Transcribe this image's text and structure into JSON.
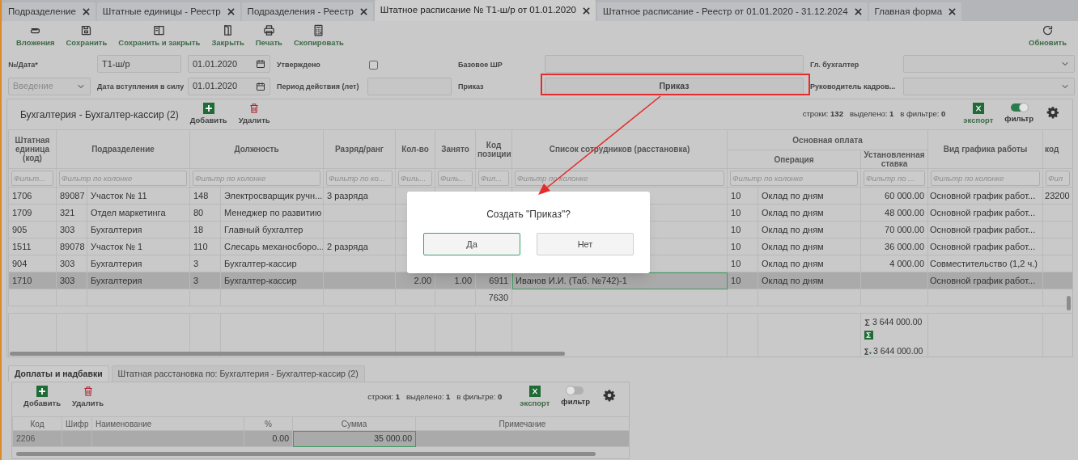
{
  "tabs": [
    {
      "label": "Подразделение",
      "selected": false
    },
    {
      "label": "Штатные единицы - Реестр",
      "selected": false
    },
    {
      "label": "Подразделения - Реестр",
      "selected": false
    },
    {
      "label": "Штатное расписание № Т1-ш/р от 01.01.2020",
      "selected": true
    },
    {
      "label": "Штатное расписание - Реестр от 01.01.2020 - 31.12.2024",
      "selected": false
    },
    {
      "label": "Главная форма",
      "selected": false
    }
  ],
  "toolbar": {
    "left": [
      "Вложения",
      "Сохранить",
      "Сохранить и закрыть",
      "Закрыть",
      "Печать",
      "Скопировать"
    ],
    "right": [
      "Обновить"
    ]
  },
  "form": {
    "number_label": "№/Дата*",
    "number": "Т1-ш/р",
    "date": "01.01.2020",
    "approved": {
      "label": "Утверждено",
      "checked": false
    },
    "base_label": "Базовое ШР",
    "chief_accountant_label": "Гл. бухгалтер",
    "stage": {
      "value": "Введение",
      "disabled": true
    },
    "effective_label": "Дата вступления в силу",
    "effective_date": "01.01.2020",
    "period_label": "Период действия (лет)",
    "order_label": "Приказ",
    "order_button": "Приказ",
    "hr_head_label": "Руководитель кадров..."
  },
  "grid": {
    "title": "Бухгалтерия - Бухгалтер-кассир (2)",
    "add": "Добавить",
    "delete": "Удалить",
    "stats": [
      "строки: **132**",
      "выделено: **1**",
      "в фильтре: **0**"
    ],
    "export": "экспорт",
    "filter": {
      "label": "фильтр",
      "on": true
    },
    "headers": [
      {
        "label": "Штатная единица (код)",
        "filter_placeholder": "Фильт..."
      },
      {
        "label": "Подразделение",
        "filter_placeholder": "Фильтр по колонке"
      },
      {
        "label": "Должность",
        "filter_placeholder": "Фильтр по колонке"
      },
      {
        "label": "Разряд/ранг",
        "filter_placeholder": "Фильтр по ко..."
      },
      {
        "label": "Кол-во",
        "filter_placeholder": "Филь..."
      },
      {
        "label": "Занято",
        "filter_placeholder": "Филь..."
      },
      {
        "label": "Код позиции",
        "filter_placeholder": "Фил..."
      },
      {
        "label": "Список сотрудников (расстановка)",
        "filter_placeholder": "Фильтр по колонке"
      },
      {
        "label": "Основная оплата",
        "children": [
          {
            "label": "Операция",
            "filter_placeholder": "Фильтр по колонке"
          },
          {
            "label": "Установленная ставка",
            "filter_placeholder": "Фильтр по ..."
          }
        ]
      },
      {
        "label": "Вид графика работы",
        "filter_placeholder": "Фильтр по колонке"
      },
      {
        "label": "код",
        "filter_placeholder": "Фил"
      }
    ],
    "rows": [
      {
        "selected": false,
        "cells": {
          "unit": "1706",
          "dept_code": "89087",
          "dept": "Участок № 11",
          "pos_code": "148",
          "position": "Электросварщик ручн...",
          "grade": "3 разряда",
          "op_code": "10",
          "operation": "Оклад по дням",
          "rate": "60 000.00",
          "schedule": "Основной график работ...",
          "column_15": "23200"
        }
      },
      {
        "selected": false,
        "cells": {
          "unit": "1709",
          "dept_code": "321",
          "dept": "Отдел маркетинга",
          "pos_code": "80",
          "position": "Менеджер по развитию",
          "op_code": "10",
          "operation": "Оклад по дням",
          "rate": "48 000.00",
          "schedule": "Основной график работ..."
        }
      },
      {
        "selected": false,
        "cells": {
          "unit": "905",
          "dept_code": "303",
          "dept": "Бухгалтерия",
          "pos_code": "18",
          "position": "Главный бухгалтер",
          "op_code": "10",
          "operation": "Оклад по дням",
          "rate": "70 000.00",
          "schedule": "Основной график работ..."
        }
      },
      {
        "selected": false,
        "cells": {
          "unit": "1511",
          "dept_code": "89078",
          "dept": "Участок № 1",
          "pos_code": "110",
          "position": "Слесарь механосборо...",
          "grade": "2 разряда",
          "op_code": "10",
          "operation": "Оклад по дням",
          "rate": "36 000.00",
          "schedule": "Основной график работ..."
        }
      },
      {
        "selected": false,
        "cells": {
          "unit": "904",
          "dept_code": "303",
          "dept": "Бухгалтерия",
          "pos_code": "3",
          "position": "Бухгалтер-кассир",
          "op_code": "10",
          "operation": "Оклад по дням",
          "rate": "4 000.00",
          "schedule": "Совместительство (1,2 ч.)"
        }
      },
      {
        "selected": true,
        "cells": {
          "unit": "1710",
          "dept_code": "303",
          "dept": "Бухгалтерия",
          "pos_code": "3",
          "position": "Бухгалтер-кассир",
          "qty": "2.00",
          "occupied": "1.00",
          "position_code": "6911",
          "employees": {
            "text": "Иванов И.И. (Таб. №742)-1",
            "focused": true
          },
          "op_code": "10",
          "operation": "Оклад по дням",
          "schedule": "Основной график работ..."
        }
      },
      {
        "selected": false,
        "cells": {
          "position_code": "7630"
        }
      }
    ],
    "totals": {
      "sum": "3 644 000.00",
      "filtered_sum": "3 644 000.00"
    }
  },
  "details": {
    "tabs": [
      {
        "label": "Доплаты и надбавки",
        "selected": true
      },
      {
        "label": "Штатная расстановка по: Бухгалтерия - Бухгалтер-кассир (2)",
        "selected": false
      }
    ],
    "add": "Добавить",
    "delete": "Удалить",
    "stats": [
      "строки: **1**",
      "выделено: **1**",
      "в фильтре: **0**"
    ],
    "export": "экспорт",
    "filter": {
      "label": "фильтр",
      "on": false
    },
    "columns": [
      "Код",
      "Шифр",
      "Наименование",
      "%",
      "Сумма",
      "Примечание"
    ],
    "rows": [
      {
        "selected": true,
        "cells": {
          "code": "2206",
          "percent": "0.00",
          "sum": {
            "text": "35 000.00",
            "focused": true
          }
        }
      }
    ]
  },
  "dialog": {
    "message": "Создать \"Приказ\"?",
    "buttons": [
      "Да",
      "Нет"
    ]
  }
}
